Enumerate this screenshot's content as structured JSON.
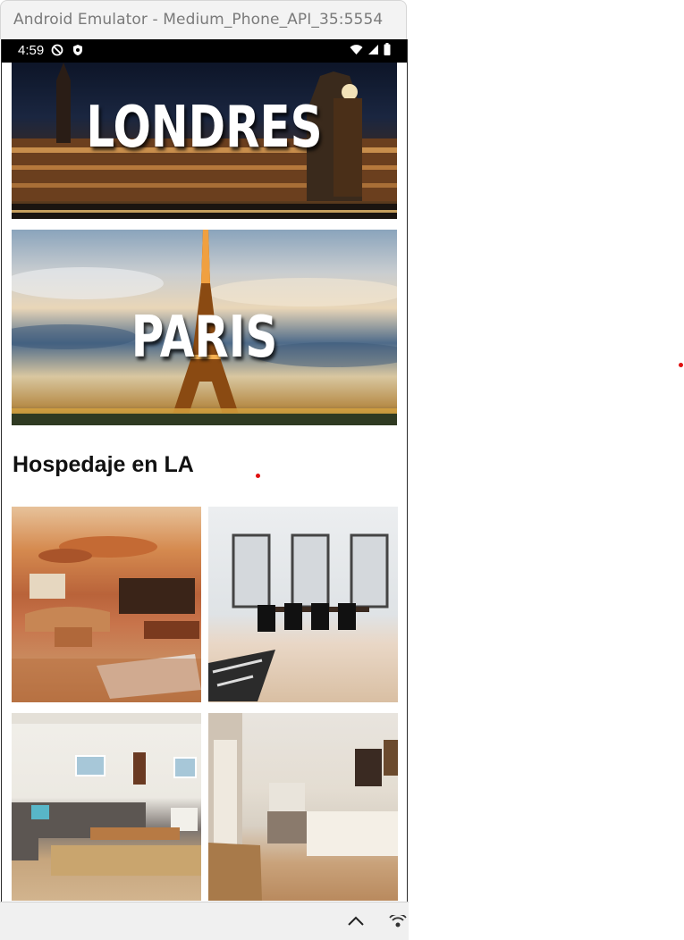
{
  "window": {
    "title": "Android Emulator - Medium_Phone_API_35:5554"
  },
  "status_bar": {
    "time": "4:59"
  },
  "banners": [
    {
      "label": "LONDRES"
    },
    {
      "label": "PARIS"
    }
  ],
  "section": {
    "title": "Hospedaje en LA"
  },
  "photos": [
    "living-room-billiards",
    "dining-room-white",
    "cozy-living-room",
    "bright-kitchen"
  ],
  "colors": {
    "accent_dot": "#e01010",
    "status_bar": "#000000"
  }
}
